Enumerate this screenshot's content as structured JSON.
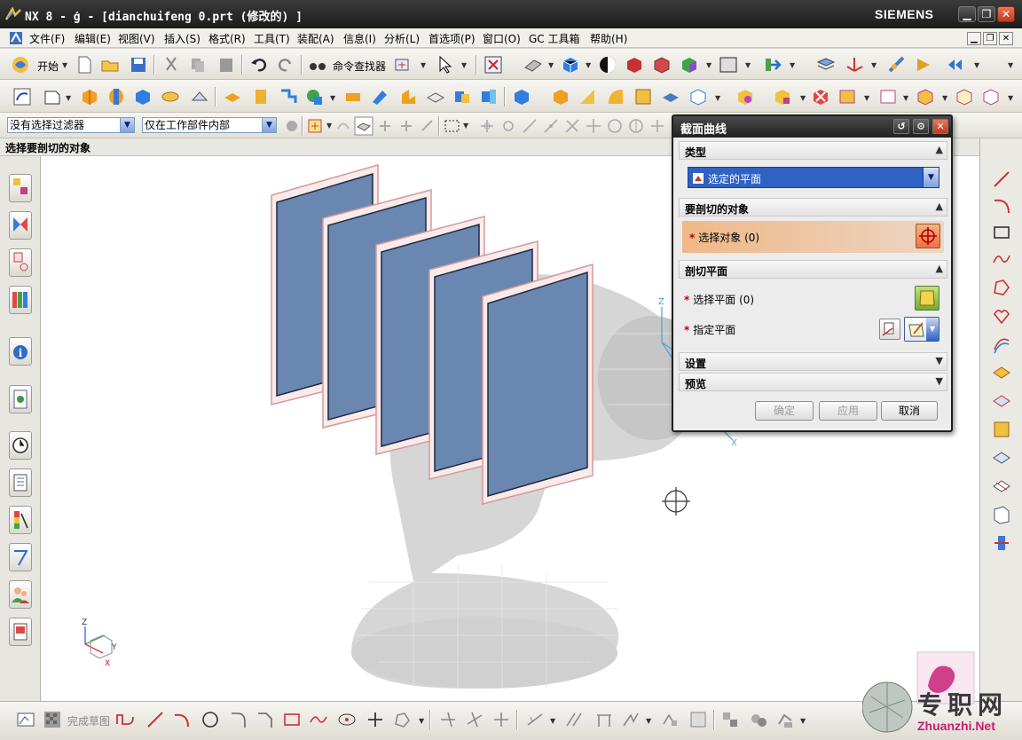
{
  "window": {
    "title": "NX 8 - ģ - [dianchuifeng 0.prt  (修改的) ]",
    "brand": "SIEMENS",
    "minimize": "▁",
    "maximize": "❐",
    "close": "✕"
  },
  "menu": {
    "items": [
      "文件(F)",
      "编辑(E)",
      "视图(V)",
      "插入(S)",
      "格式(R)",
      "工具(T)",
      "装配(A)",
      "信息(I)",
      "分析(L)",
      "首选项(P)",
      "窗口(O)",
      "GC 工具箱",
      "帮助(H)"
    ]
  },
  "toolbar_standard": {
    "start_label": "开始",
    "command_finder_label": "命令查找器"
  },
  "selection_bar": {
    "filter_value": "没有选择过滤器",
    "scope_value": "仅在工作部件内部"
  },
  "prompt": "选择要剖切的对象",
  "dialog": {
    "title": "截面曲线",
    "groups": {
      "type": {
        "label": "类型",
        "value": "选定的平面"
      },
      "objects": {
        "label": "要剖切的对象",
        "select_label": "选择对象 (0)"
      },
      "planes": {
        "label": "剖切平面",
        "select_label": "选择平面 (0)",
        "specify_label": "指定平面"
      },
      "settings": {
        "label": "设置"
      },
      "preview": {
        "label": "预览"
      }
    },
    "buttons": {
      "ok": "确定",
      "apply": "应用",
      "cancel": "取消"
    }
  },
  "bottom_toolbar": {
    "finish_sketch": "完成草图"
  },
  "triad_labels": {
    "z": "Z",
    "y": "Y",
    "x": "X"
  },
  "watermark": {
    "text": "专职网",
    "url": "Zhuanzhi.Net"
  },
  "colors": {
    "title_bar": "#1c1c1c",
    "plane_fill": "#6a87b1",
    "plane_outline": "#d49a9a",
    "highlight_row": "#f0b888",
    "dropdown_selected": "#2f62c4"
  }
}
